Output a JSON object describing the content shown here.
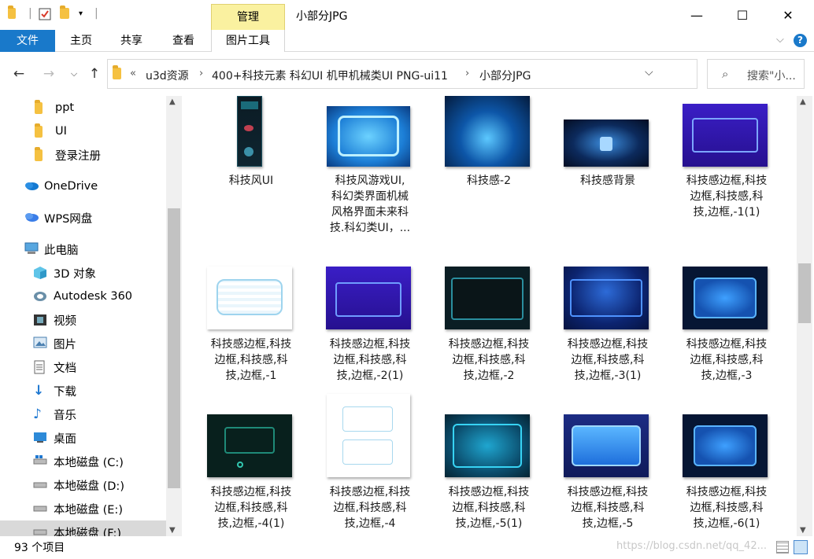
{
  "titlebar": {
    "manage_tab": "管理",
    "title": "小部分JPG",
    "minimize": "—",
    "maximize": "☐",
    "close": "✕"
  },
  "ribbon": {
    "file": "文件",
    "home": "主页",
    "share": "共享",
    "view": "查看",
    "picture_tools": "图片工具"
  },
  "address": {
    "overflow": "«",
    "crumbs": [
      "u3d资源",
      "400+科技元素 科幻UI 机甲机械类UI PNG-ui11",
      "小部分JPG"
    ]
  },
  "search": {
    "placeholder": "搜索\"小..."
  },
  "sidebar": {
    "items": [
      {
        "label": "ppt",
        "icon": "folder-icon"
      },
      {
        "label": "UI",
        "icon": "folder-icon"
      },
      {
        "label": "登录注册",
        "icon": "folder-icon"
      },
      {
        "label": "OneDrive",
        "icon": "onedrive-icon"
      },
      {
        "label": "WPS网盘",
        "icon": "wps-cloud-icon"
      },
      {
        "label": "此电脑",
        "icon": "computer-icon"
      },
      {
        "label": "3D 对象",
        "icon": "3d-objects-icon"
      },
      {
        "label": "Autodesk 360",
        "icon": "autodesk-icon"
      },
      {
        "label": "视频",
        "icon": "video-icon"
      },
      {
        "label": "图片",
        "icon": "pictures-icon"
      },
      {
        "label": "文档",
        "icon": "documents-icon"
      },
      {
        "label": "下载",
        "icon": "download-icon"
      },
      {
        "label": "音乐",
        "icon": "music-icon"
      },
      {
        "label": "桌面",
        "icon": "desktop-icon"
      },
      {
        "label": "本地磁盘 (C:)",
        "icon": "drive-c-icon"
      },
      {
        "label": "本地磁盘 (D:)",
        "icon": "drive-icon"
      },
      {
        "label": "本地磁盘 (E:)",
        "icon": "drive-icon"
      },
      {
        "label": "本地磁盘 (F:)",
        "icon": "drive-icon"
      }
    ]
  },
  "files": [
    {
      "lines": [
        "科技风UI"
      ]
    },
    {
      "lines": [
        "科技风游戏UI,",
        "科幻类界面机械",
        "风格界面未来科",
        "技.科幻类UI，..."
      ]
    },
    {
      "lines": [
        "科技感-2"
      ]
    },
    {
      "lines": [
        "科技感背景"
      ]
    },
    {
      "lines": [
        "科技感边框,科技",
        "边框,科技感,科",
        "技,边框,-1(1)"
      ]
    },
    {
      "lines": [
        "科技感边框,科技",
        "边框,科技感,科",
        "技,边框,-1"
      ]
    },
    {
      "lines": [
        "科技感边框,科技",
        "边框,科技感,科",
        "技,边框,-2(1)"
      ]
    },
    {
      "lines": [
        "科技感边框,科技",
        "边框,科技感,科",
        "技,边框,-2"
      ]
    },
    {
      "lines": [
        "科技感边框,科技",
        "边框,科技感,科",
        "技,边框,-3(1)"
      ]
    },
    {
      "lines": [
        "科技感边框,科技",
        "边框,科技感,科",
        "技,边框,-3"
      ]
    },
    {
      "lines": [
        "科技感边框,科技",
        "边框,科技感,科",
        "技,边框,-4(1)"
      ]
    },
    {
      "lines": [
        "科技感边框,科技",
        "边框,科技感,科",
        "技,边框,-4"
      ]
    },
    {
      "lines": [
        "科技感边框,科技",
        "边框,科技感,科",
        "技,边框,-5(1)"
      ]
    },
    {
      "lines": [
        "科技感边框,科技",
        "边框,科技感,科",
        "技,边框,-5"
      ]
    },
    {
      "lines": [
        "科技感边框,科技",
        "边框,科技感,科",
        "技,边框,-6(1)"
      ]
    }
  ],
  "status": {
    "item_count": "93 个项目",
    "watermark": "https://blog.csdn.net/qq_42..."
  }
}
